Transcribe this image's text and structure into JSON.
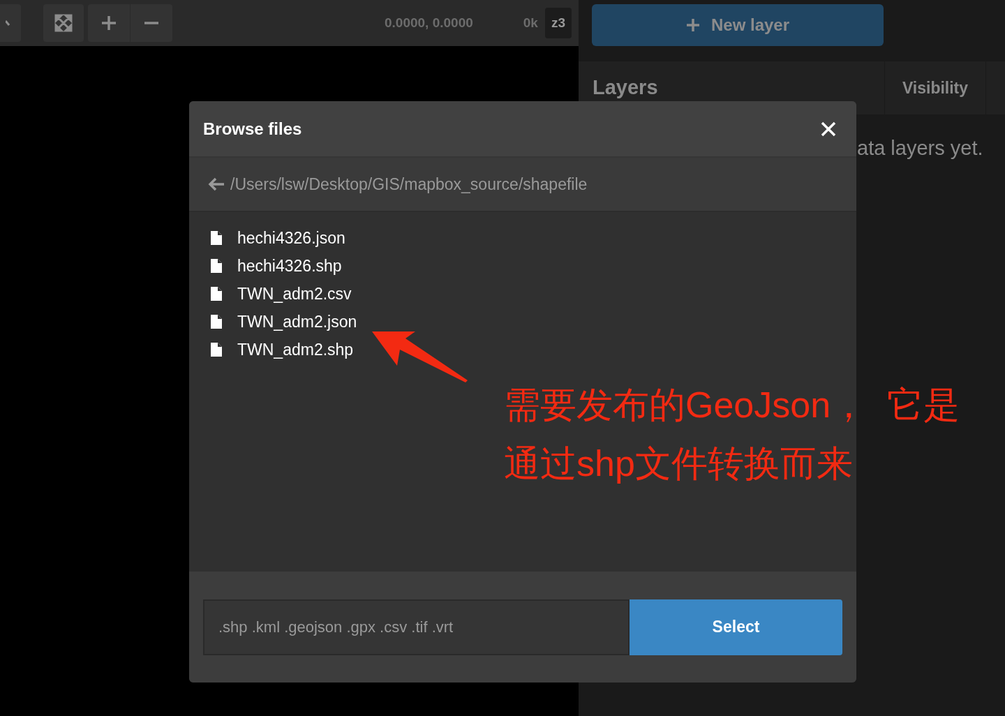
{
  "toolbar": {
    "buttons": [
      {
        "kind": "partial"
      },
      {
        "kind": "fullscreen"
      },
      {
        "kind": "zoom-in"
      },
      {
        "kind": "zoom-out"
      }
    ],
    "coordinates": "0.0000, 0.0000",
    "count": "0k",
    "zoom": "z3"
  },
  "sidebar": {
    "new_layer_button": "New layer",
    "layers_header": "Layers",
    "columns": [
      "Visibility"
    ],
    "empty_message": "ata layers yet."
  },
  "dialog": {
    "title": "Browse files",
    "path": "/Users/lsw/Desktop/GIS/mapbox_source/shapefile",
    "files": [
      "hechi4326.json",
      "hechi4326.shp",
      "TWN_adm2.csv",
      "TWN_adm2.json",
      "TWN_adm2.shp"
    ],
    "filter": {
      "placeholder": ".shp .kml .geojson .gpx .csv .tif .vrt"
    },
    "select_button": "Select"
  },
  "annotation": {
    "lines": [
      "需要发布的GeoJson，  它是",
      "通过shp文件转换而来"
    ]
  }
}
